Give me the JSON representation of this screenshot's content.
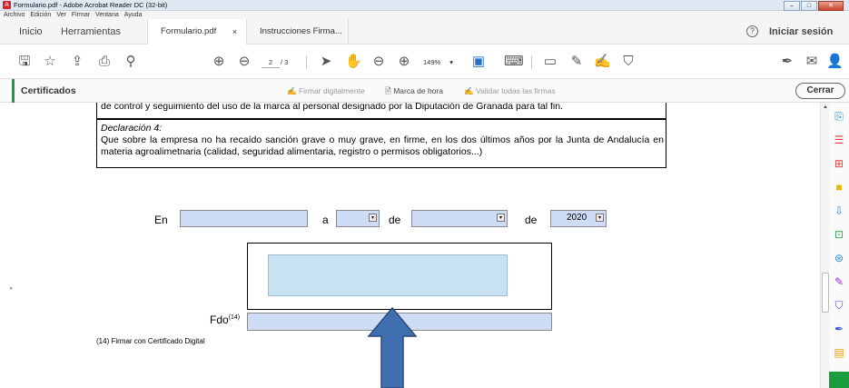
{
  "window": {
    "title": "Formulario.pdf - Adobe Acrobat Reader DC (32-bit)"
  },
  "menu": [
    "Archivo",
    "Edición",
    "Ver",
    "Firmar",
    "Ventana",
    "Ayuda"
  ],
  "tabs": {
    "home": "Inicio",
    "tools": "Herramientas",
    "documents": [
      {
        "label": "Formulario.pdf",
        "close": "×"
      },
      {
        "label": "Instrucciones Firma..."
      }
    ],
    "help": "?",
    "signin": "Iniciar sesión"
  },
  "toolbar": {
    "page_current": "2",
    "page_total": "/ 3",
    "zoom": "149%",
    "zoom_arrow": "▾"
  },
  "certbar": {
    "title": "Certificados",
    "sign_digitally": "Firmar digitalmente",
    "timestamp": "Marca de hora",
    "validate_all": "Validar todas las firmas",
    "close": "Cerrar"
  },
  "document": {
    "line_prev": "de control y seguimiento del uso de la marca al personal designado por la Diputación de Granada para tal fin.",
    "declaration_title": "Declaración 4:",
    "declaration_body": "Que sobre la empresa no ha recaído sanción grave o muy grave, en firme, en los dos últimos años por la Junta de Andalucía en materia agroalimetnaria (calidad, seguridad alimentaria, registro o permisos obligatorios...)",
    "label_en": "En",
    "label_a": "a",
    "label_de1": "de",
    "label_de2": "de",
    "year_value": "2020",
    "fdo_label": "Fdo",
    "fdo_sup": "(14)",
    "footnote": "(14) Firmar con Certificado Digital"
  },
  "colors": {
    "accent": "#1a9d3c",
    "field": "#cfdcf5",
    "signature_field": "#c9e2f1",
    "arrow": "#3f6fae"
  }
}
